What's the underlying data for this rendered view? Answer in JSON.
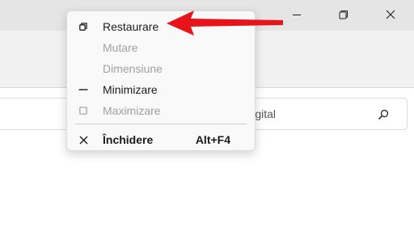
{
  "window": {
    "controls": [
      {
        "icon": "minimize-icon"
      },
      {
        "icon": "restore-icon"
      },
      {
        "icon": "close-icon"
      }
    ]
  },
  "search": {
    "placeholder": "în Digital",
    "icon": "search-icon"
  },
  "context_menu": {
    "items": [
      {
        "label": "Restaurare",
        "icon": "restore-icon",
        "enabled": true
      },
      {
        "label": "Mutare",
        "icon": "",
        "enabled": false
      },
      {
        "label": "Dimensiune",
        "icon": "",
        "enabled": false
      },
      {
        "label": "Minimizare",
        "icon": "minimize-icon",
        "enabled": true
      },
      {
        "label": "Maximizare",
        "icon": "maximize-icon",
        "enabled": false
      },
      {
        "label": "Închidere",
        "icon": "close-icon",
        "enabled": true,
        "shortcut": "Alt+F4"
      }
    ]
  },
  "annotation": {
    "arrow_color": "#e8141b"
  }
}
